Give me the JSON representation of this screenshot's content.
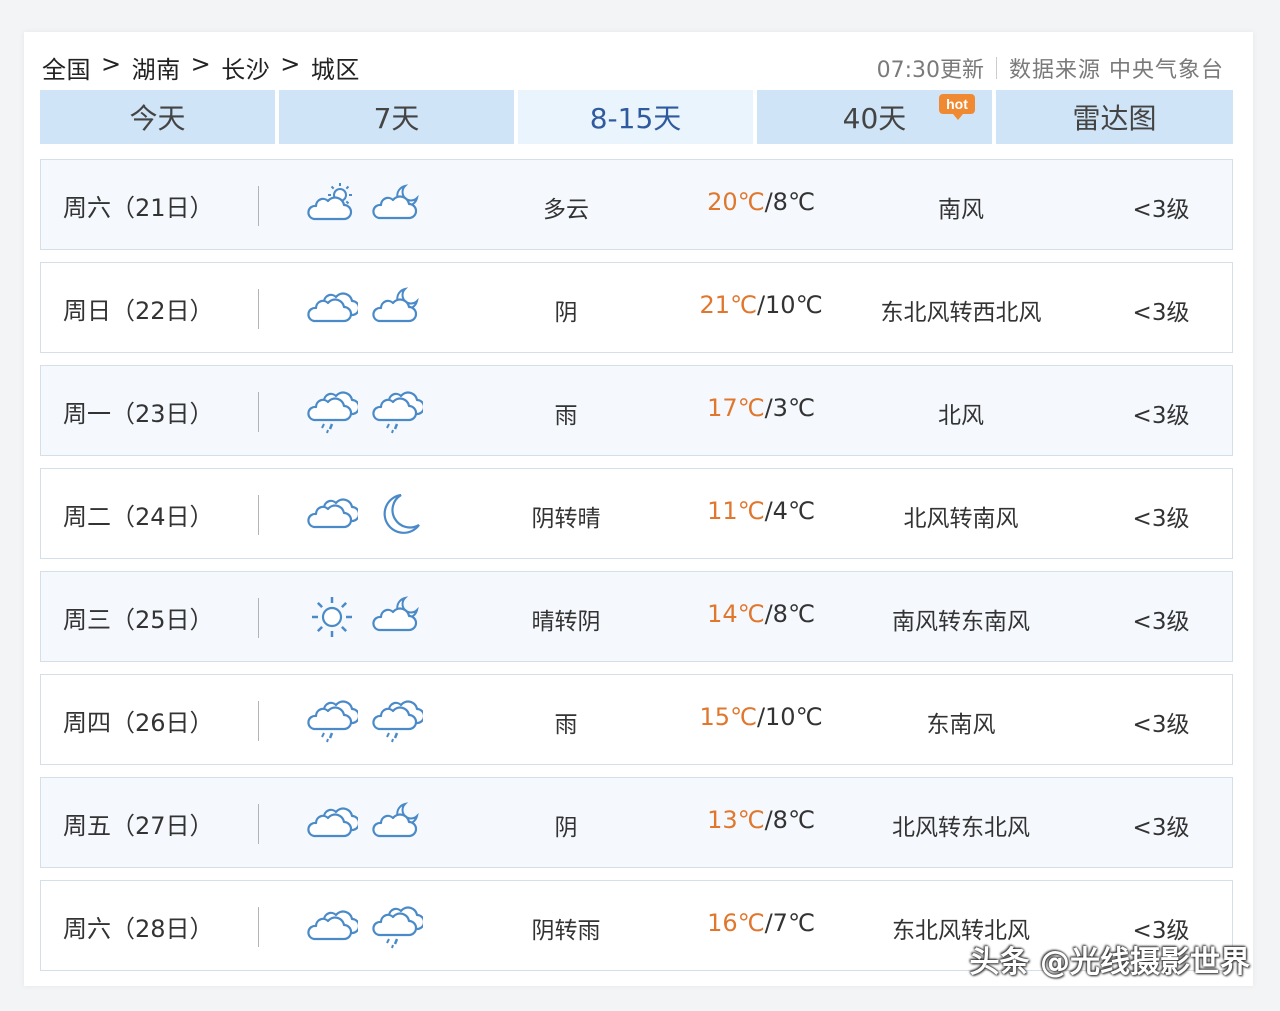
{
  "breadcrumb": [
    "全国",
    "湖南",
    "长沙",
    "城区"
  ],
  "breadcrumb_sep": ">",
  "update_time": "07:30更新",
  "data_source": "数据来源 中央气象台",
  "tabs": [
    {
      "label": "今天"
    },
    {
      "label": "7天"
    },
    {
      "label": "8-15天",
      "active": true
    },
    {
      "label": "40天",
      "badge": "hot"
    },
    {
      "label": "雷达图"
    }
  ],
  "colors": {
    "tab_bg": "#cfe4f6",
    "tab_active_bg": "#eaf4fc",
    "tab_active_text": "#2f5aa0",
    "temp_high": "#e0772d",
    "icon_stroke": "#4a8ac8",
    "hot_badge": "#f08a32"
  },
  "forecast": [
    {
      "date": "周六（21日）",
      "icon_day": "partly-cloudy-day-icon",
      "icon_night": "partly-cloudy-night-icon",
      "condition": "多云",
      "high": "20℃",
      "low": "/8℃",
      "wind": "南风",
      "level": "<3级"
    },
    {
      "date": "周日（22日）",
      "icon_day": "overcast-icon",
      "icon_night": "partly-cloudy-night-icon",
      "condition": "阴",
      "high": "21℃",
      "low": "/10℃",
      "wind": "东北风转西北风",
      "level": "<3级"
    },
    {
      "date": "周一（23日）",
      "icon_day": "rain-icon",
      "icon_night": "rain-icon",
      "condition": "雨",
      "high": "17℃",
      "low": "/3℃",
      "wind": "北风",
      "level": "<3级"
    },
    {
      "date": "周二（24日）",
      "icon_day": "overcast-icon",
      "icon_night": "clear-night-icon",
      "condition": "阴转晴",
      "high": "11℃",
      "low": "/4℃",
      "wind": "北风转南风",
      "level": "<3级"
    },
    {
      "date": "周三（25日）",
      "icon_day": "sunny-icon",
      "icon_night": "partly-cloudy-night-icon",
      "condition": "晴转阴",
      "high": "14℃",
      "low": "/8℃",
      "wind": "南风转东南风",
      "level": "<3级"
    },
    {
      "date": "周四（26日）",
      "icon_day": "rain-icon",
      "icon_night": "rain-icon",
      "condition": "雨",
      "high": "15℃",
      "low": "/10℃",
      "wind": "东南风",
      "level": "<3级"
    },
    {
      "date": "周五（27日）",
      "icon_day": "overcast-icon",
      "icon_night": "partly-cloudy-night-icon",
      "condition": "阴",
      "high": "13℃",
      "low": "/8℃",
      "wind": "北风转东北风",
      "level": "<3级"
    },
    {
      "date": "周六（28日）",
      "icon_day": "overcast-icon",
      "icon_night": "rain-icon",
      "condition": "阴转雨",
      "high": "16℃",
      "low": "/7℃",
      "wind": "东北风转北风",
      "level": "<3级"
    }
  ],
  "watermark": "头条 @光线摄影世界"
}
